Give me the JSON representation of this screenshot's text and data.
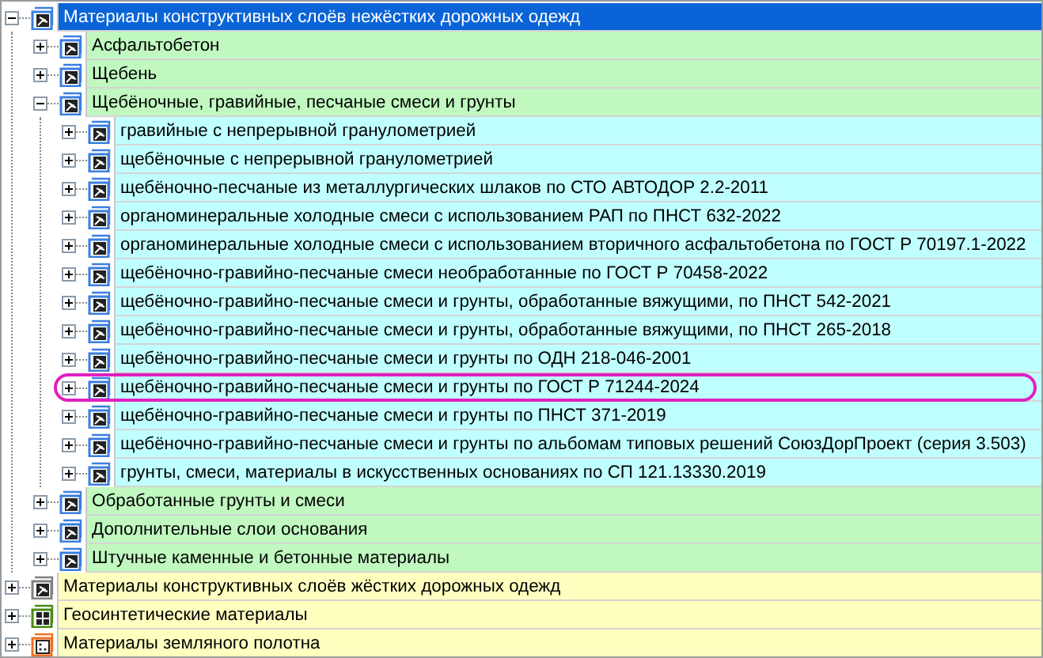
{
  "tree": [
    {
      "label": "Материалы конструктивных слоёв нежёстких дорожных одежд",
      "kind": "standard",
      "expanded": true,
      "selected": true,
      "children": [
        {
          "label": "Асфальтобетон",
          "kind": "standard",
          "expanded": false,
          "selected": false
        },
        {
          "label": "Щебень",
          "kind": "standard",
          "expanded": false,
          "selected": false
        },
        {
          "label": "Щебёночные, гравийные, песчаные смеси и грунты",
          "kind": "standard",
          "expanded": true,
          "selected": false,
          "children": [
            {
              "label": "гравийные с непрерывной гранулометрией",
              "kind": "standard",
              "expanded": false,
              "selected": false
            },
            {
              "label": "щебёночные с непрерывной гранулометрией",
              "kind": "standard",
              "expanded": false,
              "selected": false
            },
            {
              "label": "щебёночно-песчаные из металлургических шлаков по СТО АВТОДОР 2.2-2011",
              "kind": "standard",
              "expanded": false,
              "selected": false
            },
            {
              "label": "органоминеральные холодные смеси с использованием РАП по ПНСТ 632-2022",
              "kind": "standard",
              "expanded": false,
              "selected": false
            },
            {
              "label": "органоминеральные холодные смеси с использованием вторичного асфальтобетона по ГОСТ Р 70197.1-2022",
              "kind": "standard",
              "expanded": false,
              "selected": false
            },
            {
              "label": "щебёночно-гравийно-песчаные смеси необработанные по ГОСТ Р 70458-2022",
              "kind": "standard",
              "expanded": false,
              "selected": false
            },
            {
              "label": "щебёночно-гравийно-песчаные смеси и грунты, обработанные вяжущими, по ПНСТ 542-2021",
              "kind": "standard",
              "expanded": false,
              "selected": false
            },
            {
              "label": "щебёночно-гравийно-песчаные смеси и грунты, обработанные вяжущими, по ПНСТ 265-2018",
              "kind": "standard",
              "expanded": false,
              "selected": false
            },
            {
              "label": "щебёночно-гравийно-песчаные смеси и грунты по ОДН 218-046-2001",
              "kind": "standard",
              "expanded": false,
              "selected": false
            },
            {
              "label": "щебёночно-гравийно-песчаные смеси и грунты по ГОСТ Р 71244-2024",
              "kind": "standard",
              "expanded": false,
              "selected": false,
              "highlighted": true
            },
            {
              "label": "щебёночно-гравийно-песчаные смеси и грунты по ПНСТ 371-2019",
              "kind": "standard",
              "expanded": false,
              "selected": false
            },
            {
              "label": "щебёночно-гравийно-песчаные смеси и грунты по альбомам типовых решений СоюзДорПроект (серия 3.503)",
              "kind": "standard",
              "expanded": false,
              "selected": false
            },
            {
              "label": "грунты, смеси, материалы в искусственных основаниях по СП 121.13330.2019",
              "kind": "standard",
              "expanded": false,
              "selected": false
            }
          ]
        },
        {
          "label": "Обработанные грунты и смеси",
          "kind": "standard",
          "expanded": false,
          "selected": false
        },
        {
          "label": "Дополнительные слои основания",
          "kind": "standard",
          "expanded": false,
          "selected": false
        },
        {
          "label": "Штучные каменные и бетонные материалы",
          "kind": "standard",
          "expanded": false,
          "selected": false
        }
      ]
    },
    {
      "label": "Материалы конструктивных слоёв жёстких дорожных одежд",
      "kind": "grey",
      "expanded": false,
      "selected": false
    },
    {
      "label": "Геосинтетические материалы",
      "kind": "grid",
      "expanded": false,
      "selected": false
    },
    {
      "label": "Материалы земляного полотна",
      "kind": "dots",
      "expanded": false,
      "selected": false
    }
  ]
}
